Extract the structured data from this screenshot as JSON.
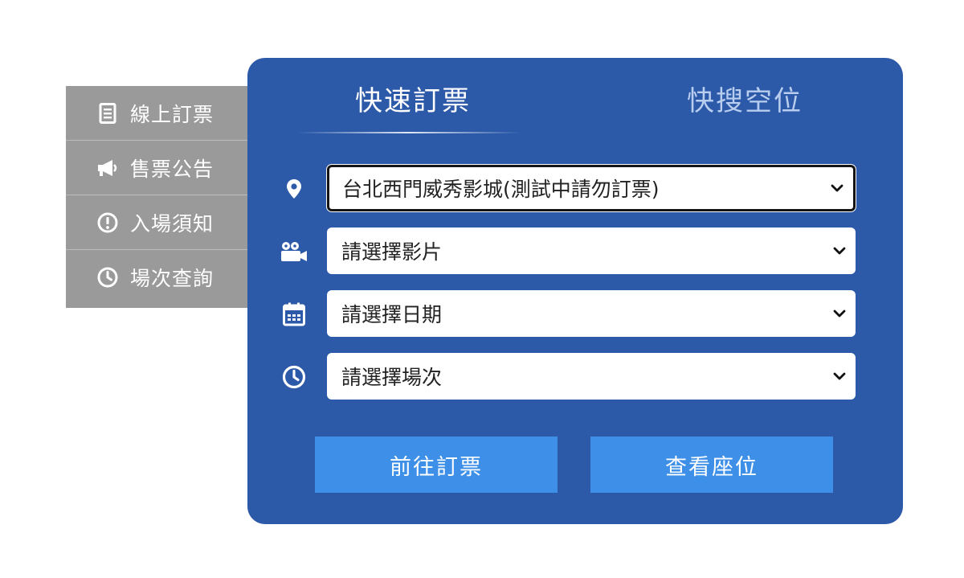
{
  "side_menu": {
    "items": [
      {
        "label": "線上訂票",
        "icon": "document-icon"
      },
      {
        "label": "售票公告",
        "icon": "megaphone-icon"
      },
      {
        "label": "入場須知",
        "icon": "exclamation-circle-icon"
      },
      {
        "label": "場次查詢",
        "icon": "clock-icon"
      }
    ]
  },
  "panel": {
    "tabs": [
      {
        "label": "快速訂票",
        "active": true
      },
      {
        "label": "快搜空位",
        "active": false
      }
    ],
    "fields": [
      {
        "icon": "map-pin-icon",
        "value": "台北西門威秀影城(測試中請勿訂票)",
        "focused": true
      },
      {
        "icon": "video-camera-icon",
        "value": "請選擇影片",
        "focused": false
      },
      {
        "icon": "calendar-icon",
        "value": "請選擇日期",
        "focused": false
      },
      {
        "icon": "clock-icon",
        "value": "請選擇場次",
        "focused": false
      }
    ],
    "buttons": {
      "book": "前往訂票",
      "seats": "查看座位"
    }
  },
  "colors": {
    "panel_bg": "#2c5aa9",
    "button_bg": "#3d8fe8",
    "side_bg": "#9a9a9a",
    "tab_inactive": "#b9cdee"
  }
}
